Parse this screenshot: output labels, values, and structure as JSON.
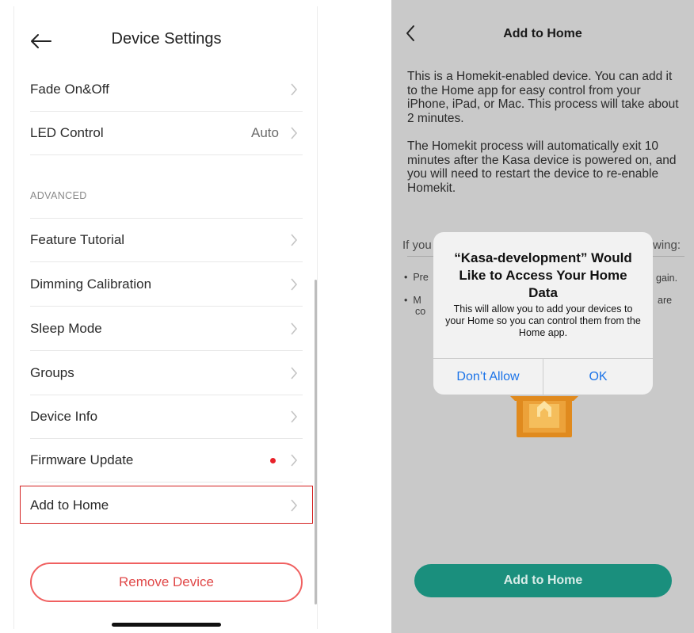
{
  "left": {
    "title": "Device Settings",
    "rows_top": [
      {
        "label": "Fade On&Off",
        "value": ""
      },
      {
        "label": "LED Control",
        "value": "Auto"
      }
    ],
    "section_header": "ADVANCED",
    "rows_advanced": [
      {
        "label": "Feature Tutorial"
      },
      {
        "label": "Dimming Calibration"
      },
      {
        "label": "Sleep Mode"
      },
      {
        "label": "Groups"
      },
      {
        "label": "Device Info"
      },
      {
        "label": "Firmware Update"
      },
      {
        "label": "Add to Home"
      }
    ],
    "remove_button": "Remove Device"
  },
  "right": {
    "title": "Add to Home",
    "paragraph1": "This is a Homekit-enabled device. You can add it to the Home app for easy control from your iPhone, iPad, or Mac. This process will take about 2 minutes.",
    "paragraph2": "The Homekit process will automatically exit 10 minutes after the Kasa device is powered on, and you will need to restart the device to re-enable Homekit.",
    "partial_left": "If you",
    "partial_right": "wing:",
    "bullet1_left": "Pre",
    "bullet1_right": "gain.",
    "bullet2_left": "M",
    "bullet2_left2": "co",
    "bullet2_right": "are",
    "alert": {
      "title": "“Kasa-development” Would Like to Access Your Home Data",
      "message": "This will allow you to add your devices to your Home so you can control them from the Home app.",
      "deny": "Don’t Allow",
      "ok": "OK"
    },
    "add_button": "Add to Home"
  },
  "colors": {
    "accent_red": "#e04848",
    "highlight_red": "#d42222",
    "teal_button": "#1a8f7d",
    "ios_blue": "#1b73e8",
    "box_orange": "#e08a1e"
  }
}
